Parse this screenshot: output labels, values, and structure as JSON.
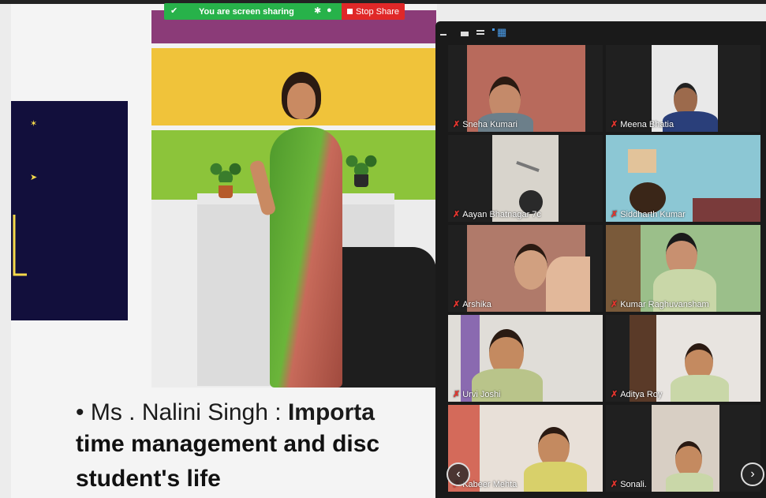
{
  "share_bar": {
    "status_text": "You are screen sharing",
    "stop_label": "Stop Share"
  },
  "slide": {
    "bullet_text": "• Ms . Nalini Singh : ",
    "bullet_bold": "Importa",
    "line2": "time management and disc",
    "line3": "student's life"
  },
  "gallery": {
    "toolbar_icons": [
      "minimize-icon",
      "fit-icon",
      "speaker-view-icon",
      "gallery-view-icon"
    ],
    "participants": [
      {
        "name": "Sneha Kumari"
      },
      {
        "name": "Meena Bhatia"
      },
      {
        "name": "Aayan Bhatnagar 7c"
      },
      {
        "name": "Siddharth Kumar"
      },
      {
        "name": "Arshika"
      },
      {
        "name": "Kumar Raghuvansham"
      },
      {
        "name": "Urvi Joshi"
      },
      {
        "name": "Aditya Roy"
      },
      {
        "name": "Kabeer Mehta"
      },
      {
        "name": "Sonali."
      }
    ],
    "prev_label": "‹",
    "next_label": "›"
  },
  "colors": {
    "share_green": "#27b24a",
    "stop_red": "#e02828",
    "slide_navy": "#120f3c",
    "muted_mic": "#e5362f"
  }
}
